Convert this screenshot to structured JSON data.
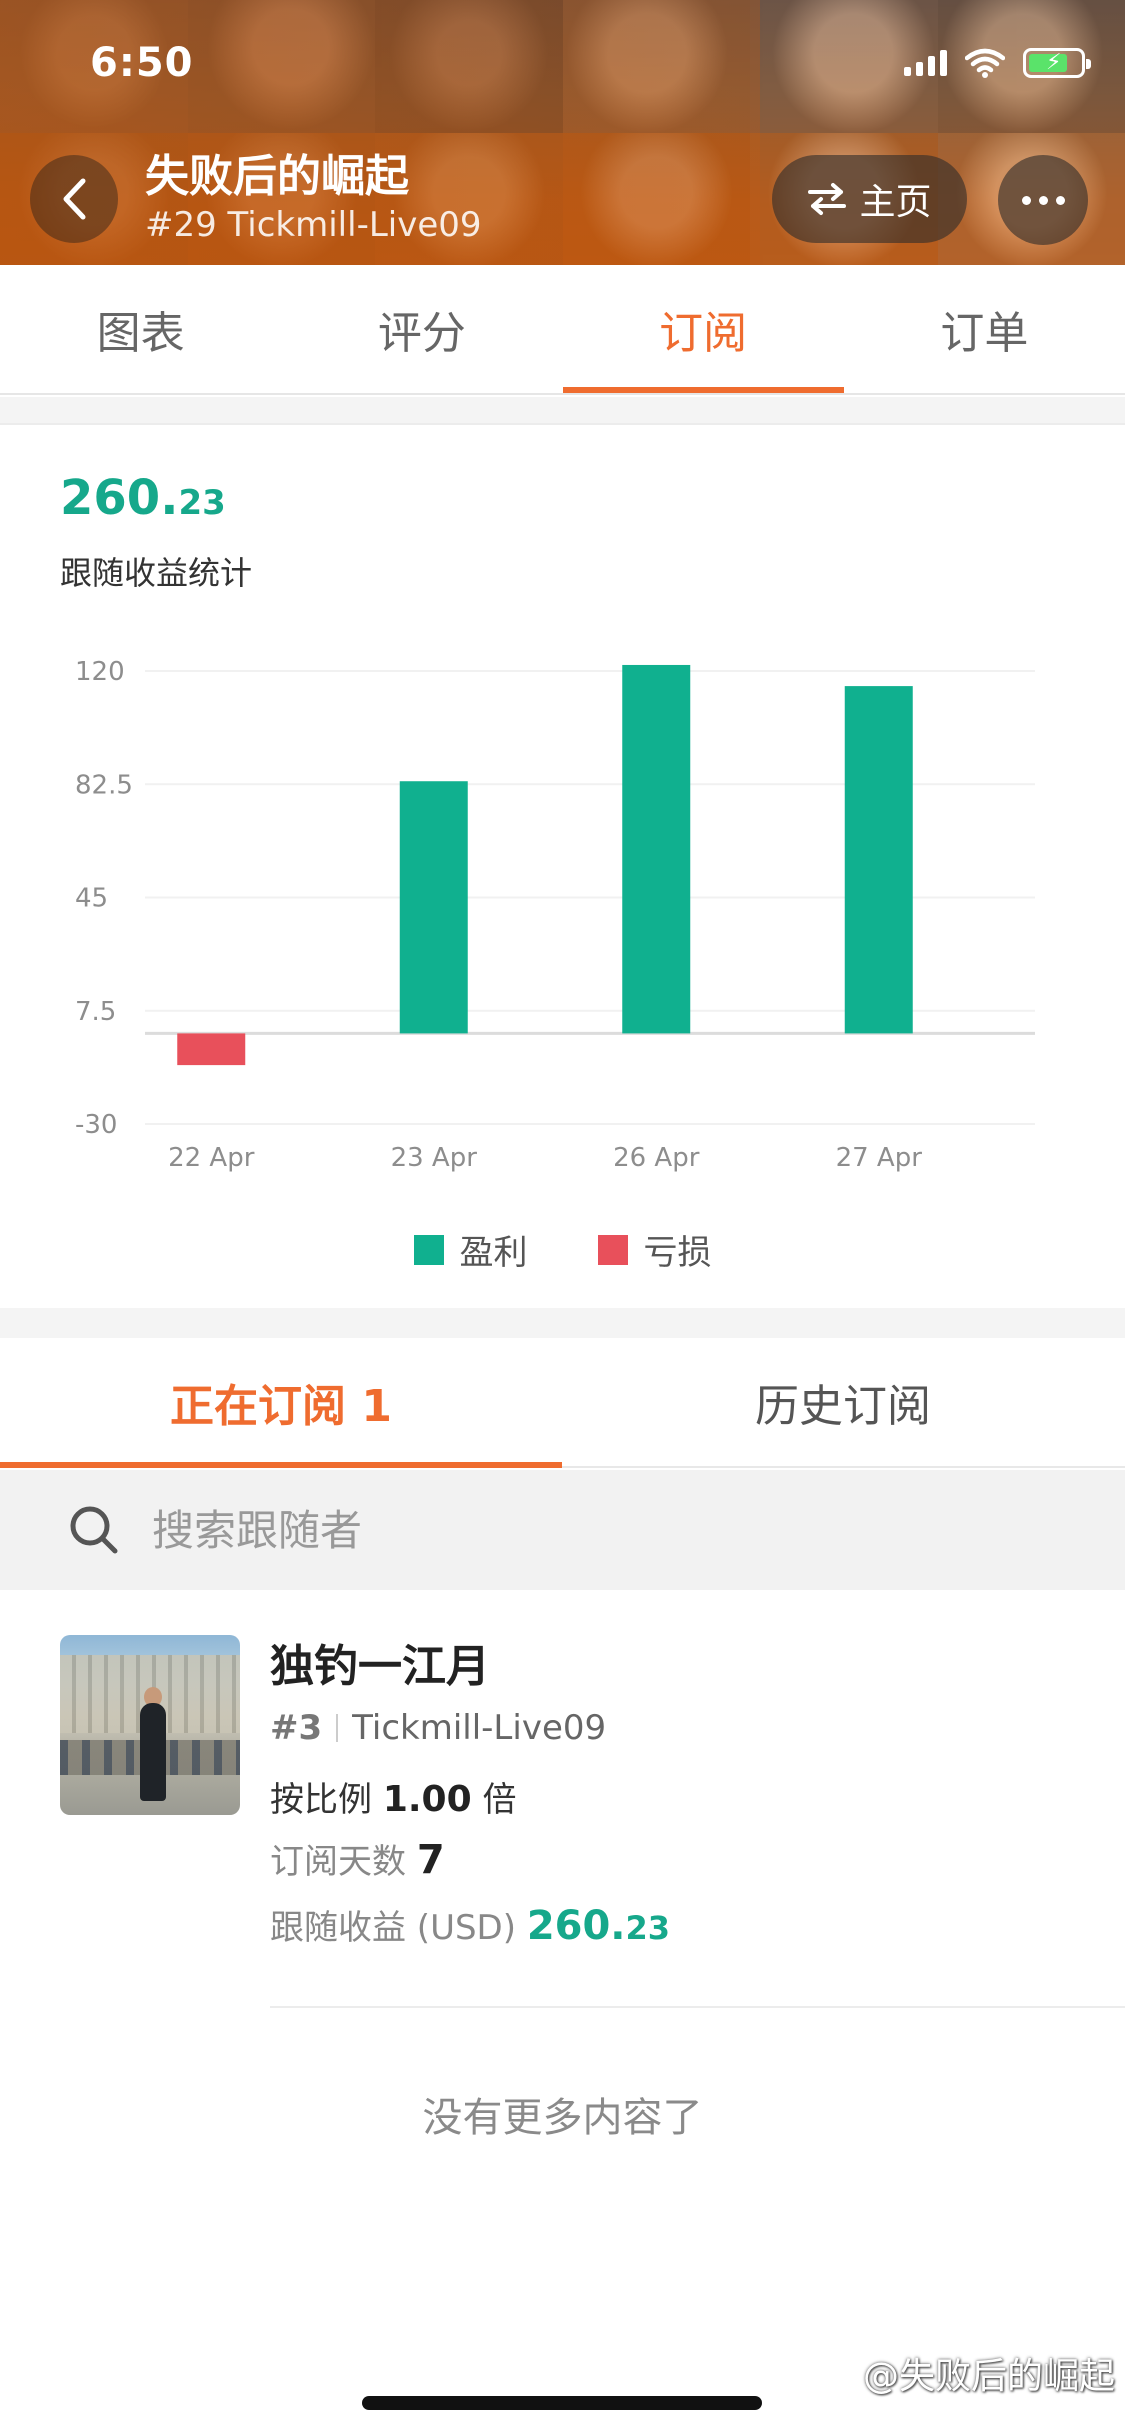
{
  "status_bar": {
    "time": "6:50"
  },
  "header": {
    "title": "失败后的崛起",
    "subtitle": "#29 Tickmill-Live09",
    "home_label": "主页"
  },
  "tabs": [
    {
      "label": "图表"
    },
    {
      "label": "评分"
    },
    {
      "label": "订阅",
      "active": true
    },
    {
      "label": "订单"
    }
  ],
  "summary": {
    "total_int": "260.",
    "total_dec": "23",
    "label": "跟随收益统计"
  },
  "chart_data": {
    "type": "bar",
    "categories": [
      "22 Apr",
      "23 Apr",
      "26 Apr",
      "27 Apr"
    ],
    "values": [
      -10.5,
      83.5,
      122,
      115
    ],
    "y_ticks": [
      "120",
      "82.5",
      "45",
      "7.5",
      "-30"
    ],
    "ylim": [
      -30,
      120
    ],
    "colors": {
      "profit": "#10b08f",
      "loss": "#e8505b"
    },
    "legend": [
      {
        "label": "盈利",
        "color": "#10b08f"
      },
      {
        "label": "亏损",
        "color": "#e8505b"
      }
    ],
    "legend_position": "bottom"
  },
  "subtabs": [
    {
      "label": "正在订阅 1",
      "active": true
    },
    {
      "label": "历史订阅"
    }
  ],
  "search": {
    "placeholder": "搜索跟随者"
  },
  "followers": [
    {
      "name": "独钓一江月",
      "rank": "#3",
      "account": "Tickmill-Live09",
      "ratio_label": "按比例",
      "ratio_value": "1.00",
      "ratio_unit": "倍",
      "days_label": "订阅天数",
      "days_value": "7",
      "profit_label": "跟随收益 (USD)",
      "profit_int": "260.",
      "profit_dec": "23"
    }
  ],
  "footer": {
    "no_more": "没有更多内容了",
    "watermark": "@失败后的崛起"
  },
  "colors": {
    "accent": "#ef6c2f",
    "positive": "#16a88b"
  }
}
